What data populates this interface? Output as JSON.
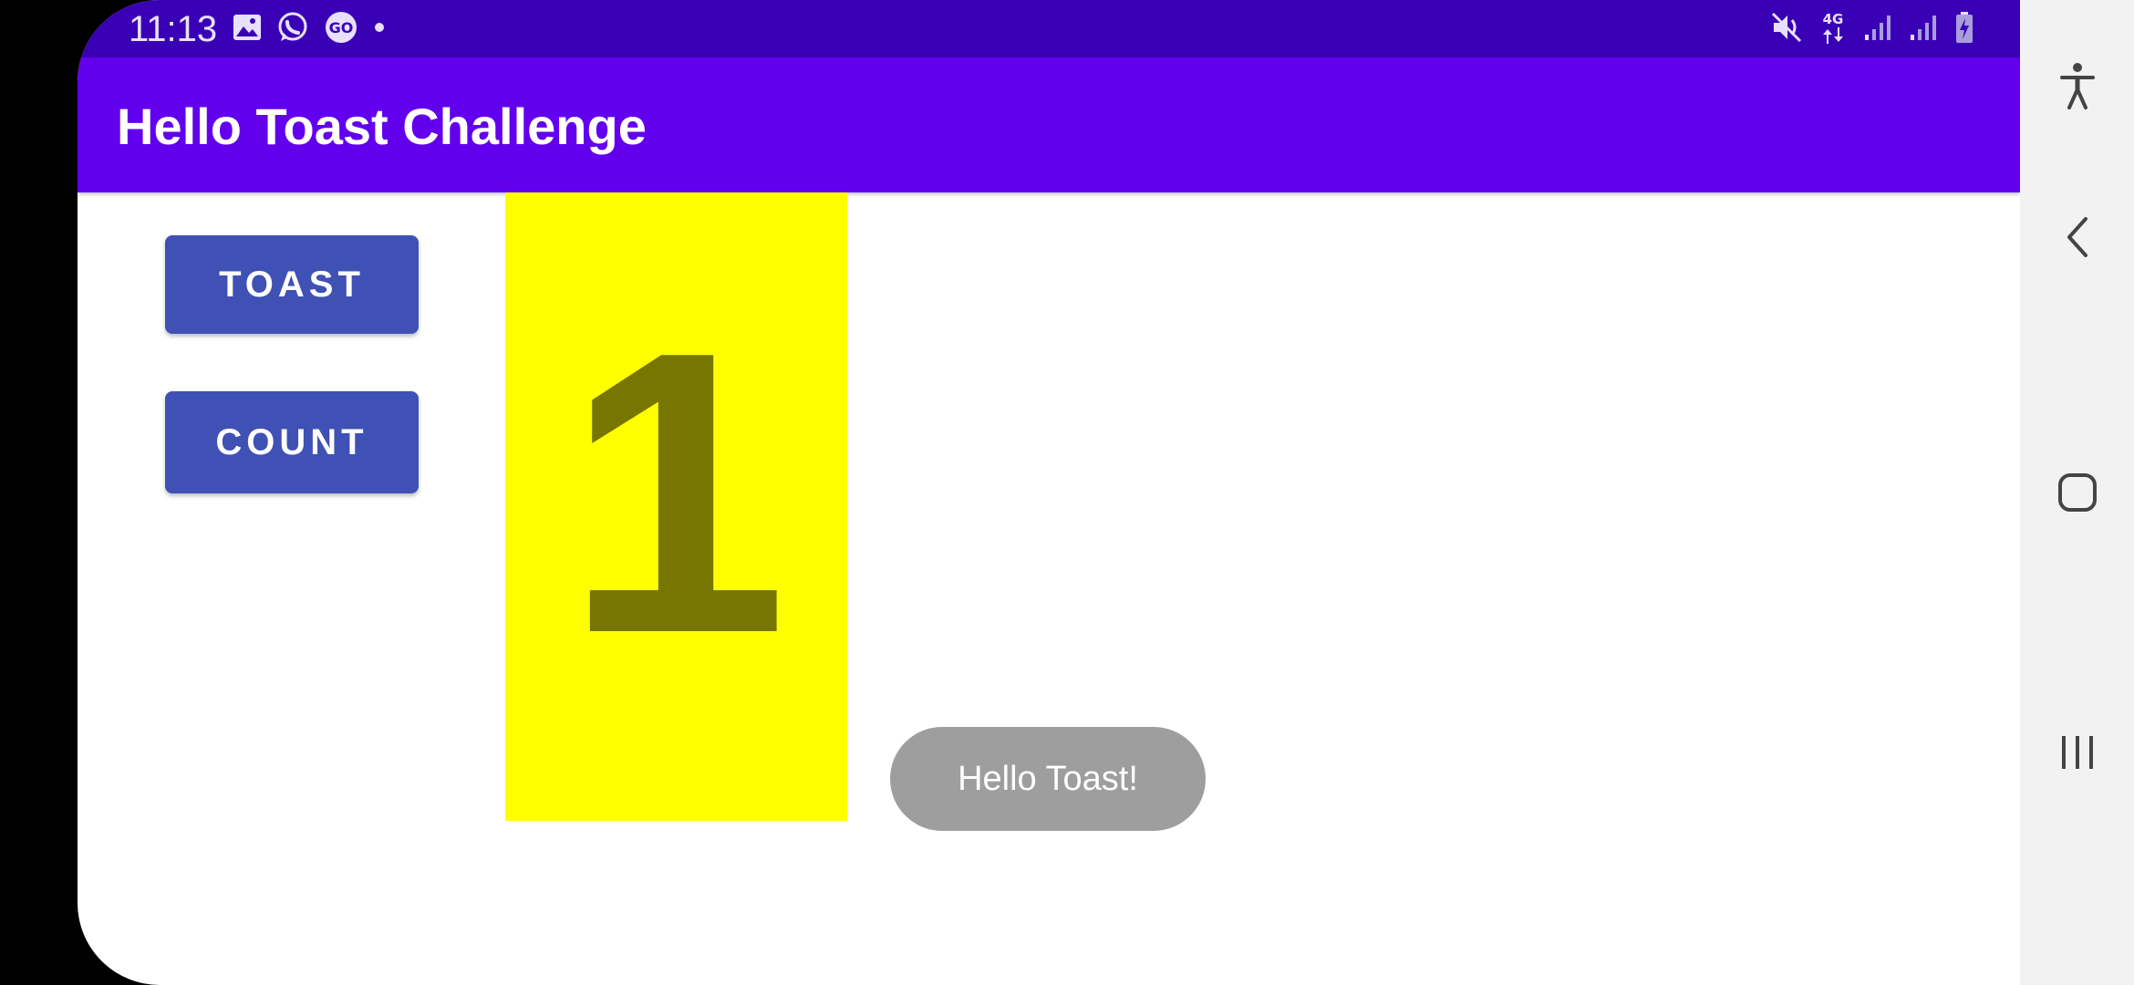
{
  "status_bar": {
    "time": "11:13",
    "left_icons": [
      "gallery-icon",
      "whatsapp-icon",
      "go-icon",
      "dot-icon"
    ],
    "right_icons": [
      "mute-icon",
      "network-4g-icon",
      "signal-icon",
      "signal-icon",
      "battery-charging-icon"
    ],
    "network_label": "4G"
  },
  "app_bar": {
    "title": "Hello Toast Challenge"
  },
  "buttons": {
    "toast_label": "TOAST",
    "count_label": "COUNT"
  },
  "counter": {
    "value": "1"
  },
  "toast": {
    "message": "Hello Toast!"
  },
  "nav_bar": {
    "items": [
      "accessibility-icon",
      "back-icon",
      "home-icon",
      "recents-icon"
    ]
  },
  "colors": {
    "status_bar": "#3a00b5",
    "app_bar": "#6200ee",
    "button": "#3f51b5",
    "counter_bg": "#ffff00",
    "counter_text": "#777600",
    "toast_bg": "#9e9e9e"
  }
}
